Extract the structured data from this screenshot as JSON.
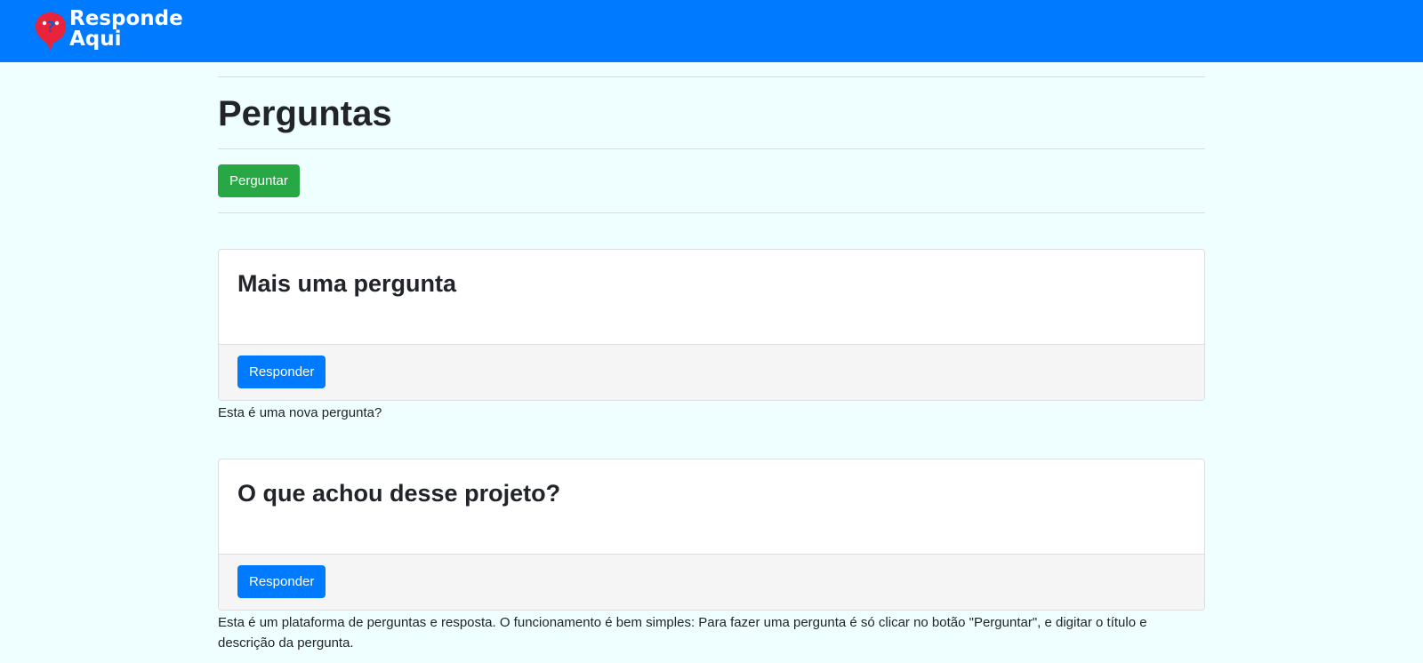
{
  "navbar": {
    "brand_line1": "Responde",
    "brand_line2": "Aqui",
    "logo_icon": "question-pin-icon",
    "background_color": "#007bff",
    "logo_color": "#e8243c"
  },
  "page": {
    "title": "Perguntas",
    "ask_button_label": "Perguntar",
    "background_color": "#efffff"
  },
  "questions": [
    {
      "title": "Mais uma pergunta",
      "answer_button_label": "Responder",
      "description": "Esta é uma nova pergunta?"
    },
    {
      "title": "O que achou desse projeto?",
      "answer_button_label": "Responder",
      "description": "Esta é um plataforma de perguntas e resposta. O funcionamento é bem simples: Para fazer uma pergunta é só clicar no botão \"Perguntar\", e digitar o título e descrição da pergunta."
    }
  ]
}
